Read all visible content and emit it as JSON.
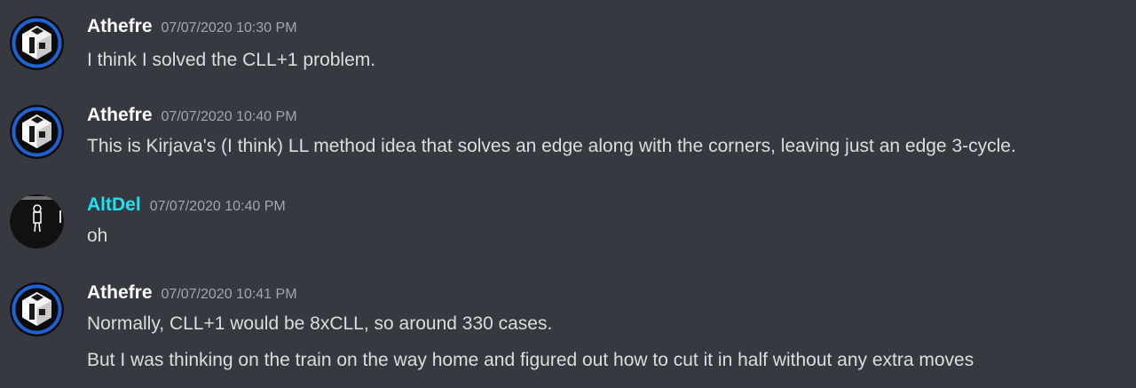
{
  "messages": [
    {
      "author": "Athefre",
      "timestamp": "07/07/2020 10:30 PM",
      "lines": [
        "I think I solved the CLL+1 problem."
      ]
    },
    {
      "author": "Athefre",
      "timestamp": "07/07/2020 10:40 PM",
      "lines": [
        "This is Kirjava's (I think) LL method idea that solves an edge along with the corners, leaving just an edge 3-cycle."
      ]
    },
    {
      "author": "AltDel",
      "timestamp": "07/07/2020 10:40 PM",
      "lines": [
        "oh"
      ]
    },
    {
      "author": "Athefre",
      "timestamp": "07/07/2020 10:41 PM",
      "lines": [
        "Normally, CLL+1 would be 8xCLL, so around 330 cases.",
        "But I was thinking on the train on the way home and figured out how to cut it in half without any extra moves"
      ]
    }
  ],
  "colors": {
    "background": "#36393f",
    "username_default": "#ffffff",
    "username_altdel": "#1de2f5",
    "timestamp": "#a3a6aa",
    "message_text": "#dcddde"
  },
  "icons": {
    "athefre_avatar": "cube-logo-icon",
    "altdel_avatar": "stick-figure-icon"
  }
}
